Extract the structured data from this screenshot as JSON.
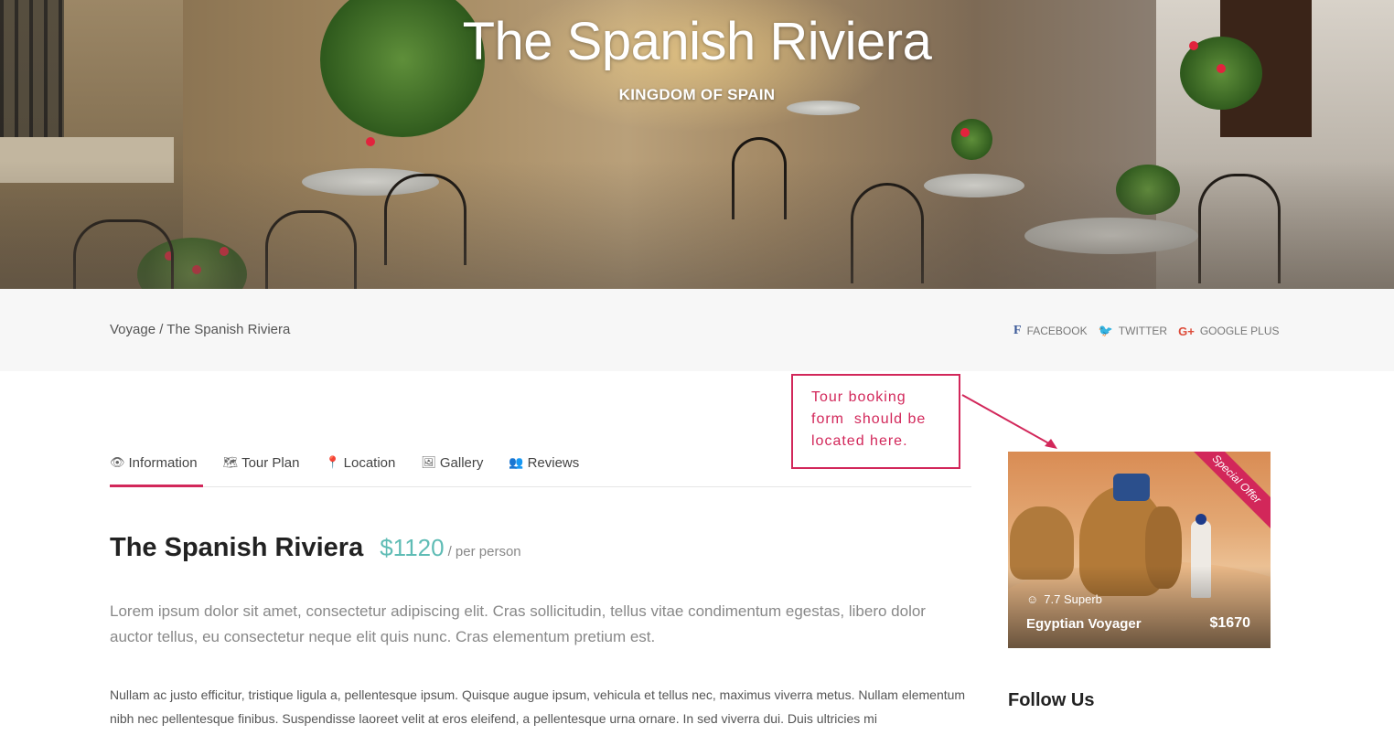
{
  "hero": {
    "title": "The Spanish Riviera",
    "subtitle": "KINGDOM OF SPAIN"
  },
  "breadcrumb": {
    "parent": "Voyage",
    "separator": " / ",
    "current": "The Spanish Riviera"
  },
  "share": {
    "facebook": "FACEBOOK",
    "twitter": "TWITTER",
    "google": "GOOGLE PLUS",
    "facebook_icon": "f",
    "twitter_icon": "🐦",
    "google_icon": "G+"
  },
  "annotation": {
    "text": "Tour booking form should be located here.",
    "line1": "Tour booking",
    "line2": "form  should be",
    "line3": "located here.",
    "color": "#d2275a"
  },
  "tabs": [
    {
      "label": "Information",
      "icon": "eye-icon",
      "active": true
    },
    {
      "label": "Tour Plan",
      "icon": "map-icon",
      "active": false
    },
    {
      "label": "Location",
      "icon": "pin-icon",
      "active": false
    },
    {
      "label": "Gallery",
      "icon": "image-icon",
      "active": false
    },
    {
      "label": "Reviews",
      "icon": "users-icon",
      "active": false
    }
  ],
  "tour": {
    "title": "The Spanish Riviera",
    "price": "$1120",
    "price_unit": "/ per person",
    "lead": "Lorem ipsum dolor sit amet, consectetur adipiscing elit. Cras sollicitudin, tellus vitae condimentum egestas, libero dolor auctor tellus, eu consectetur neque elit quis nunc. Cras elementum pretium est.",
    "body": "Nullam ac justo efficitur, tristique ligula a, pellentesque ipsum. Quisque augue ipsum, vehicula et tellus nec, maximus viverra metus. Nullam elementum nibh nec pellentesque finibus. Suspendisse laoreet velit at eros eleifend, a pellentesque urna ornare. In sed viverra dui. Duis ultricies mi"
  },
  "offer": {
    "ribbon": "Special Offer",
    "rating": "7.7 Superb",
    "name": "Egyptian Voyager",
    "price": "$1670"
  },
  "sidebar": {
    "follow_title": "Follow Us"
  },
  "colors": {
    "accent": "#d2275a",
    "price": "#5fbcb5"
  }
}
